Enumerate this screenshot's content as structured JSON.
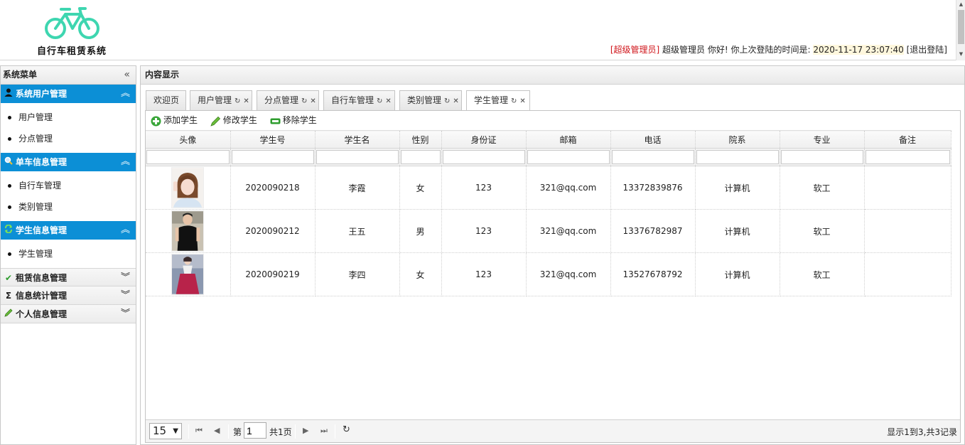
{
  "app": {
    "title": "自行车租赁系统"
  },
  "header": {
    "role": "[超级管理员]",
    "greeting": "超级管理员 你好! 你上次登陆的时间是:",
    "last_login": "2020-11-17 23:07:40",
    "logout": "[退出登陆]"
  },
  "sidebar": {
    "title": "系统菜单",
    "groups": [
      {
        "label": "系统用户管理",
        "icon": "user-icon",
        "open": true,
        "items": [
          "用户管理",
          "分点管理"
        ]
      },
      {
        "label": "单车信息管理",
        "icon": "magnifier-icon",
        "open": true,
        "items": [
          "自行车管理",
          "类别管理"
        ]
      },
      {
        "label": "学生信息管理",
        "icon": "refresh-icon",
        "open": true,
        "items": [
          "学生管理"
        ]
      },
      {
        "label": "租赁信息管理",
        "icon": "check-icon",
        "open": false
      },
      {
        "label": "信息统计管理",
        "icon": "sigma-icon",
        "open": false
      },
      {
        "label": "个人信息管理",
        "icon": "pencil-icon",
        "open": false
      }
    ]
  },
  "main": {
    "title": "内容显示",
    "tabs": [
      {
        "label": "欢迎页",
        "closable": false
      },
      {
        "label": "用户管理",
        "closable": true
      },
      {
        "label": "分点管理",
        "closable": true
      },
      {
        "label": "自行车管理",
        "closable": true
      },
      {
        "label": "类别管理",
        "closable": true
      },
      {
        "label": "学生管理",
        "closable": true,
        "active": true
      }
    ],
    "toolbar": {
      "add": "添加学生",
      "edit": "修改学生",
      "remove": "移除学生"
    },
    "table": {
      "columns": [
        "头像",
        "学生号",
        "学生名",
        "性别",
        "身份证",
        "邮箱",
        "电话",
        "院系",
        "专业",
        "备注"
      ],
      "rows": [
        {
          "id": "2020090218",
          "name": "李霞",
          "gender": "女",
          "idcard": "123",
          "email": "321@qq.com",
          "phone": "13372839876",
          "dept": "计算机",
          "major": "软工",
          "note": ""
        },
        {
          "id": "2020090212",
          "name": "王五",
          "gender": "男",
          "idcard": "123",
          "email": "321@qq.com",
          "phone": "13376782987",
          "dept": "计算机",
          "major": "软工",
          "note": ""
        },
        {
          "id": "2020090219",
          "name": "李四",
          "gender": "女",
          "idcard": "123",
          "email": "321@qq.com",
          "phone": "13527678792",
          "dept": "计算机",
          "major": "软工",
          "note": ""
        }
      ]
    },
    "pager": {
      "page_size": "15",
      "page_prefix": "第",
      "page_value": "1",
      "page_total": "共1页",
      "summary": "显示1到3,共3记录"
    }
  },
  "colors": {
    "accent": "#0c8fd6",
    "logo": "#3ed6b0",
    "role": "#d0141a"
  }
}
